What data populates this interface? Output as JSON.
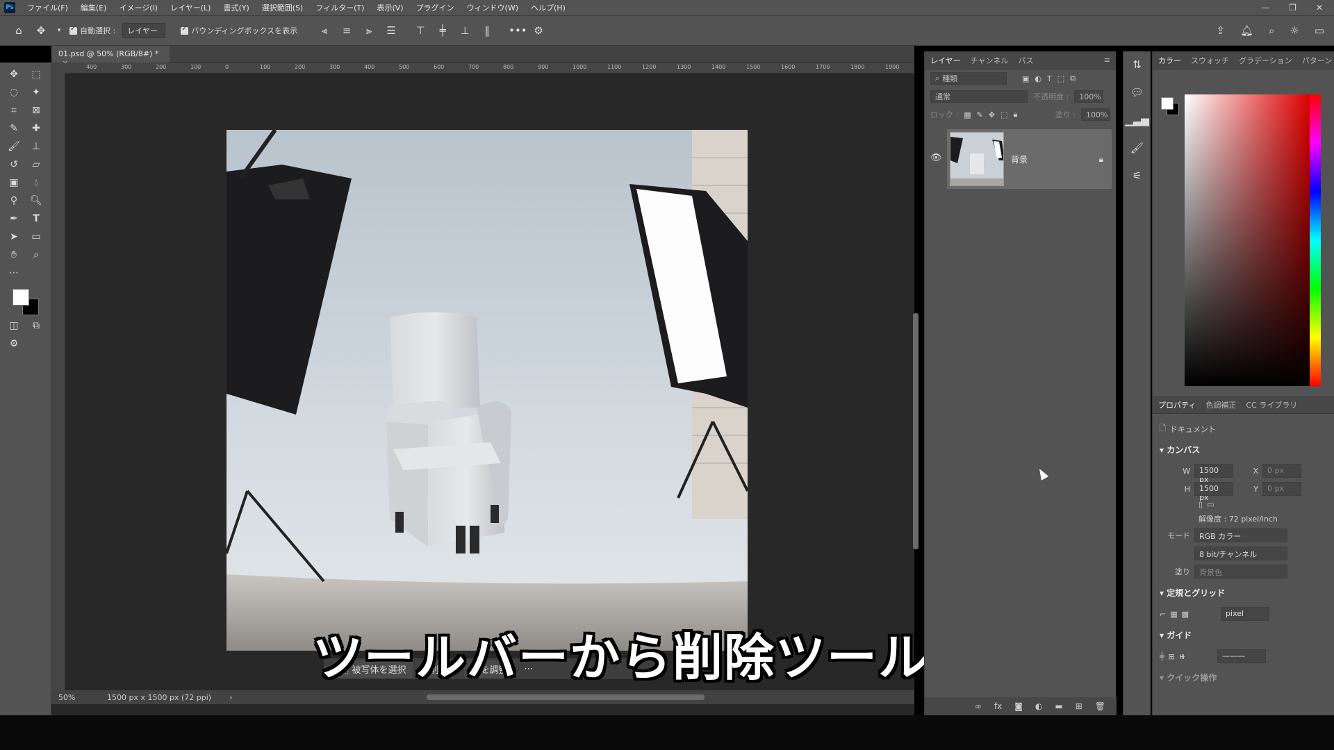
{
  "menu": [
    "ファイル(F)",
    "編集(E)",
    "イメージ(I)",
    "レイヤー(L)",
    "書式(Y)",
    "選択範囲(S)",
    "フィルター(T)",
    "表示(V)",
    "プラグイン",
    "ウィンドウ(W)",
    "ヘルプ(H)"
  ],
  "app_logo": "Ps",
  "window_controls": [
    "—",
    "❐",
    "✕"
  ],
  "options": {
    "auto_select_label": "自動選択 :",
    "layer_select": "レイヤー",
    "bbox_label": "バウンディングボックスを表示",
    "more": "•••"
  },
  "doc": {
    "tab_title": "01.psd @ 50% (RGB/8#) *",
    "ruler_labels": [
      "400",
      "300",
      "200",
      "100",
      "0",
      "100",
      "200",
      "300",
      "400",
      "500",
      "600",
      "700",
      "800",
      "900",
      "1000",
      "1100",
      "1200",
      "1300",
      "1400",
      "1500",
      "1600",
      "1700",
      "1800",
      "1900"
    ],
    "zoom": "50%",
    "doc_info": "1500 px x 1500 px (72 ppi)"
  },
  "taskbar": {
    "select_subject": "被写体を選択",
    "item2": "削除",
    "item3": "ーを調整"
  },
  "subtitle": "ツールバーから削除ツールを",
  "layers_panel": {
    "tabs": [
      "レイヤー",
      "チャンネル",
      "パス"
    ],
    "search_kind": "種類",
    "blend_mode": "通常",
    "opacity_label": "不透明度 :",
    "opacity_value": "100%",
    "lock_label": "ロック :",
    "fill_label": "塗り :",
    "fill_value": "100%",
    "layer_name": "背景"
  },
  "color_panel": {
    "tabs": [
      "カラー",
      "スウォッチ",
      "グラデーション",
      "パターン"
    ]
  },
  "properties": {
    "tabs": [
      "プロパティ",
      "色調補正",
      "CC ライブラリ"
    ],
    "doc_label": "ドキュメント",
    "canvas_title": "カンバス",
    "w_label": "W",
    "w_value": "1500 px",
    "h_label": "H",
    "h_value": "1500 px",
    "x_label": "X",
    "x_value": "0 px",
    "y_label": "Y",
    "y_value": "0 px",
    "resolution": "解像度 : 72 pixel/inch",
    "mode_label": "モード",
    "mode_value": "RGB カラー",
    "bit_value": "8 bit/チャンネル",
    "fill_label": "塗り",
    "fill_value": "背景色",
    "rulers_title": "定規とグリッド",
    "unit": "pixel",
    "guides_title": "ガイド",
    "next_title": "クイック操作"
  }
}
